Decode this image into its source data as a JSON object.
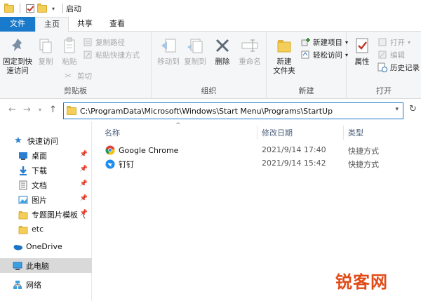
{
  "window": {
    "title": "启动"
  },
  "tabs": [
    {
      "label": "文件"
    },
    {
      "label": "主页"
    },
    {
      "label": "共享"
    },
    {
      "label": "查看"
    }
  ],
  "ribbon": {
    "clipboard": {
      "label": "剪贴板",
      "pin_quick_access": "固定到快\n速访问",
      "copy": "复制",
      "paste": "粘贴",
      "copy_path": "复制路径",
      "paste_shortcut": "粘贴快捷方式",
      "cut": "剪切"
    },
    "organize": {
      "label": "组织",
      "move_to": "移动到",
      "copy_to": "复制到",
      "delete": "删除",
      "rename": "重命名"
    },
    "new": {
      "label": "新建",
      "new_folder": "新建\n文件夹",
      "new_item": "新建项目",
      "easy_access": "轻松访问"
    },
    "open": {
      "label": "打开",
      "properties": "属性",
      "open": "打开",
      "edit": "编辑",
      "history": "历史记录"
    }
  },
  "address": {
    "path": "C:\\ProgramData\\Microsoft\\Windows\\Start Menu\\Programs\\StartUp"
  },
  "sidebar": {
    "items": [
      {
        "label": "快速访问"
      },
      {
        "label": "桌面"
      },
      {
        "label": "下载"
      },
      {
        "label": "文档"
      },
      {
        "label": "图片"
      },
      {
        "label": "专题图片模板（"
      },
      {
        "label": "etc"
      },
      {
        "label": "OneDrive"
      },
      {
        "label": "此电脑"
      },
      {
        "label": "网络"
      }
    ]
  },
  "columns": {
    "name": "名称",
    "modified": "修改日期",
    "type": "类型"
  },
  "files": [
    {
      "name": "Google Chrome",
      "modified": "2021/9/14 17:40",
      "type": "快捷方式"
    },
    {
      "name": "钉钉",
      "modified": "2021/9/14 15:42",
      "type": "快捷方式"
    }
  ],
  "watermark": "锐客网",
  "colors": {
    "accent": "#1979ca",
    "folder": "#f3cf59",
    "watermark": "#e24b17"
  }
}
